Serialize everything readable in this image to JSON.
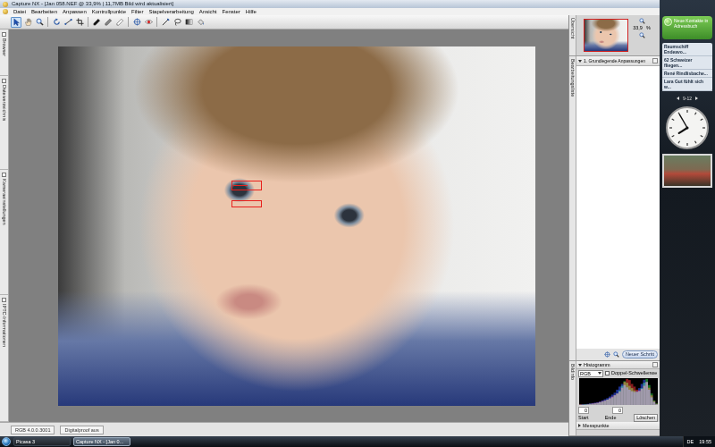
{
  "window": {
    "title": "Capture NX - [Jan 058.NEF @ 33,9% | 11,7MB Bild wird aktualisiert]"
  },
  "menu": [
    "Datei",
    "Bearbeiten",
    "Anpassen",
    "Kontrollpunkte",
    "Filter",
    "Stapelverarbeitung",
    "Ansicht",
    "Fenster",
    "Hilfe"
  ],
  "toolbar": [
    {
      "kind": "arrow",
      "selected": true
    },
    {
      "kind": "hand",
      "selected": false
    },
    {
      "kind": "zoom",
      "selected": false
    },
    {
      "kind": "separator"
    },
    {
      "kind": "rotate",
      "selected": false
    },
    {
      "kind": "straighten",
      "selected": false
    },
    {
      "kind": "crop",
      "selected": false
    },
    {
      "kind": "separator"
    },
    {
      "kind": "blackpoint",
      "selected": false
    },
    {
      "kind": "neutralpoint",
      "selected": false
    },
    {
      "kind": "whitepoint",
      "selected": false
    },
    {
      "kind": "separator"
    },
    {
      "kind": "colorpoint",
      "selected": false
    },
    {
      "kind": "redeye",
      "selected": false
    },
    {
      "kind": "separator"
    },
    {
      "kind": "line",
      "selected": false
    },
    {
      "kind": "lasso",
      "selected": false
    },
    {
      "kind": "gradient",
      "selected": false
    },
    {
      "kind": "fill",
      "selected": false
    }
  ],
  "left_panels": [
    {
      "label": "Browser",
      "expanded": false
    },
    {
      "label": "Dateiverzeichnis",
      "expanded": false
    },
    {
      "label": "Kameraeinstellungen",
      "expanded": false
    },
    {
      "label": "IPTC-Informationen",
      "expanded": false
    }
  ],
  "status_bar": [
    "RGB 4.0.0.3001",
    "Digitalproof aus"
  ],
  "right_panel": {
    "tabs": [
      "Übersicht",
      "Bearbeitungsliste",
      "Bildinfo"
    ],
    "zoom": "33,9",
    "zoom_unit": "%",
    "steps": [
      {
        "label": "1. Grundlegende Anpassungen",
        "expanded": true
      }
    ],
    "new_step": "Neuer Schritt"
  },
  "histogram": {
    "title": "Histogramm",
    "expanded": true,
    "channel": "RGB",
    "double_threshold": {
      "label": "Doppel-Schwellenwe",
      "checked": false
    },
    "start": "0",
    "end": "0",
    "start_label": "Start",
    "end_label": "Ende",
    "clear": "Löschen",
    "series": [
      {
        "name": "red",
        "color": "#e03030",
        "values": [
          2,
          1,
          1,
          2,
          3,
          4,
          5,
          6,
          8,
          10,
          12,
          14,
          18,
          22,
          26,
          30,
          35,
          45,
          60,
          68,
          65,
          55,
          48,
          40,
          38,
          42,
          50,
          60,
          45,
          25,
          10,
          3
        ]
      },
      {
        "name": "green",
        "color": "#30c040",
        "values": [
          1,
          1,
          2,
          2,
          3,
          3,
          4,
          5,
          7,
          9,
          11,
          14,
          17,
          20,
          25,
          30,
          38,
          50,
          62,
          58,
          50,
          44,
          38,
          34,
          36,
          44,
          58,
          68,
          52,
          30,
          12,
          4
        ]
      },
      {
        "name": "blue",
        "color": "#3050f0",
        "values": [
          1,
          2,
          2,
          3,
          4,
          5,
          6,
          7,
          9,
          12,
          15,
          18,
          22,
          27,
          32,
          40,
          48,
          55,
          52,
          46,
          40,
          36,
          34,
          36,
          44,
          55,
          66,
          60,
          40,
          20,
          8,
          2
        ]
      }
    ]
  },
  "measure_points": {
    "label": "Messpunkte",
    "expanded": false
  },
  "sidebar": {
    "notice": "Neue Kontakte in Adressbuch",
    "feeds": [
      "Raumschiff Endeavo...",
      "62 Schweizer fliegen...",
      "René Rindlisbache...",
      "Lara Gut fühlt sich w..."
    ],
    "pager": "9-12",
    "clock": {
      "hour": 19,
      "minute": 55
    }
  },
  "taskbar": {
    "items": [
      {
        "label": "Picasa 3",
        "selected": false
      },
      {
        "label": "Capture NX - [Jan 0...",
        "selected": true
      }
    ],
    "tray": "DE",
    "time": "19:55"
  }
}
